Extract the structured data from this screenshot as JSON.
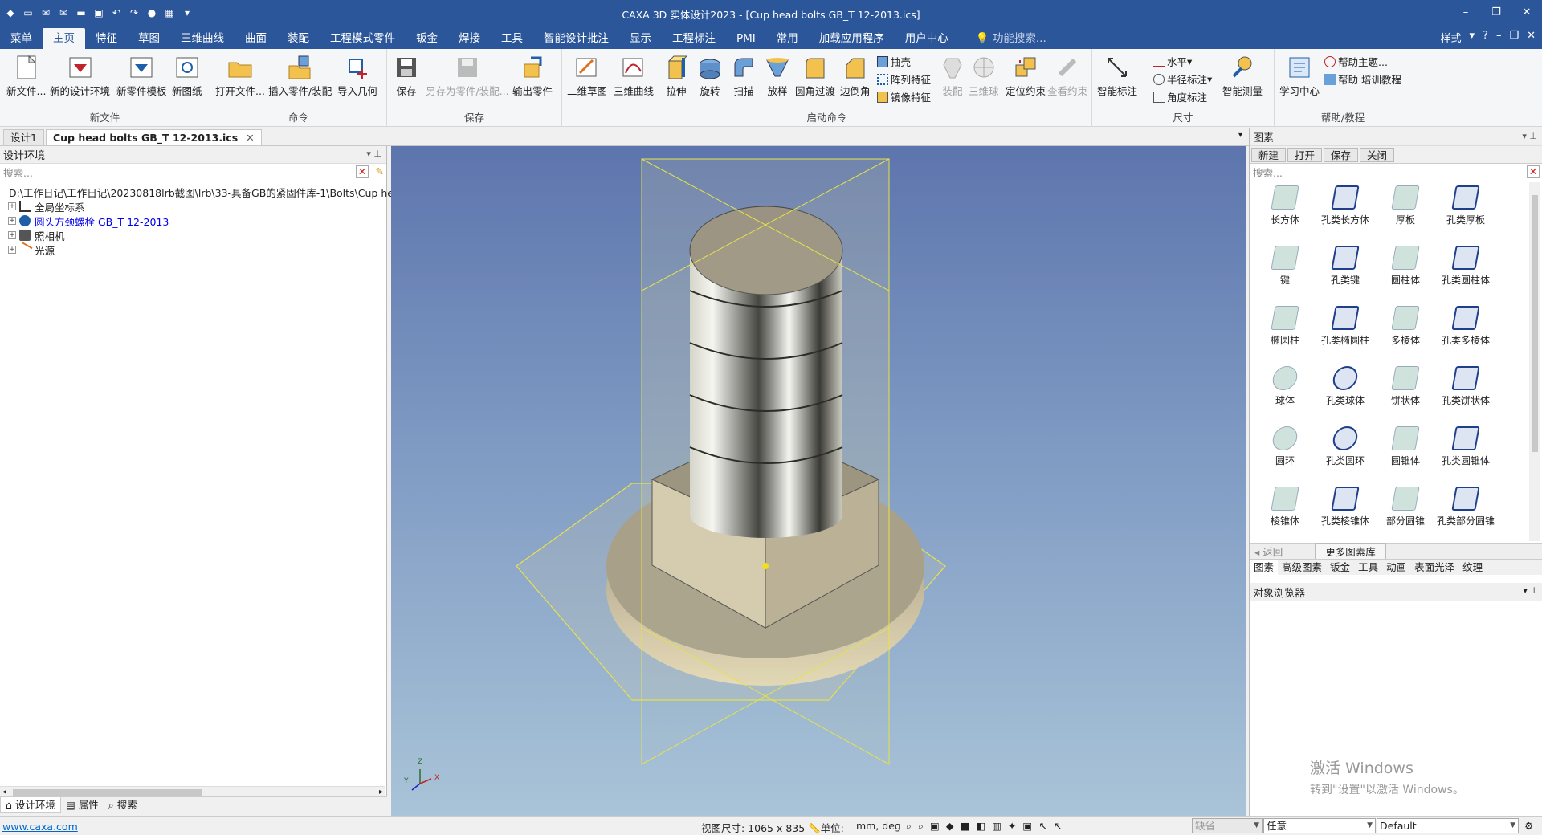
{
  "window": {
    "title": "CAXA 3D 实体设计2023 - [Cup head bolts GB_T 12-2013.ics]",
    "controls": [
      "–",
      "❐",
      "✕"
    ]
  },
  "menubar": {
    "items": [
      "菜单",
      "主页",
      "特征",
      "草图",
      "三维曲线",
      "曲面",
      "装配",
      "工程模式零件",
      "钣金",
      "焊接",
      "工具",
      "智能设计批注",
      "显示",
      "工程标注",
      "PMI",
      "常用",
      "加载应用程序",
      "用户中心"
    ],
    "active": "主页",
    "search_placeholder": "功能搜索...",
    "style_label": "样式"
  },
  "ribbon": {
    "groups": {
      "new_file": {
        "label": "新文件",
        "buttons": [
          "新文件...",
          "新的设计环境",
          "新零件模板",
          "新图纸"
        ]
      },
      "command": {
        "label": "命令",
        "buttons": [
          "打开文件...",
          "插入零件/装配",
          "导入几何"
        ]
      },
      "save": {
        "label": "保存",
        "buttons": [
          "保存",
          "另存为零件/装配...",
          "输出零件"
        ]
      },
      "launch": {
        "label": "启动命令",
        "buttons": [
          "二维草图",
          "三维曲线",
          "拉伸",
          "旋转",
          "扫描",
          "放样",
          "圆角过渡",
          "边倒角"
        ],
        "small": [
          "抽壳",
          "阵列特征",
          "镜像特征"
        ],
        "disabled": [
          "装配",
          "三维球"
        ],
        "more": [
          "定位约束",
          "查看约束"
        ]
      },
      "dimension": {
        "label": "尺寸",
        "buttons": [
          "智能标注",
          "智能测量"
        ],
        "small": [
          "水平",
          "半径标注",
          "角度标注"
        ]
      },
      "help": {
        "label": "帮助/教程",
        "buttons": [
          "学习中心"
        ],
        "small": [
          "帮助主题...",
          "帮助 培训教程"
        ]
      }
    }
  },
  "doc_tabs": [
    "设计1",
    "Cup head bolts GB_T 12-2013.ics"
  ],
  "left_panel": {
    "title": "设计环境",
    "search_placeholder": "搜索...",
    "tree": [
      {
        "label": "D:\\工作日记\\工作日记\\20230818lrb截图\\lrb\\33-具备GB的紧固件库-1\\Bolts\\Cup he"
      },
      {
        "label": "全局坐标系"
      },
      {
        "label": "圆头方颈螺栓 GB_T 12-2013",
        "color": "#0000ee"
      },
      {
        "label": "照相机"
      },
      {
        "label": "光源"
      }
    ],
    "tabs": [
      "设计环境",
      "属性",
      "搜索"
    ]
  },
  "right_panel": {
    "title": "图素",
    "toolbar": [
      "新建",
      "打开",
      "保存",
      "关闭"
    ],
    "search_placeholder": "搜索...",
    "items": [
      "长方体",
      "孔类长方体",
      "厚板",
      "孔类厚板",
      "键",
      "孔类键",
      "圆柱体",
      "孔类圆柱体",
      "椭圆柱",
      "孔类椭圆柱",
      "多棱体",
      "孔类多棱体",
      "球体",
      "孔类球体",
      "饼状体",
      "孔类饼状体",
      "圆环",
      "孔类圆环",
      "圆锥体",
      "孔类圆锥体",
      "棱锥体",
      "孔类棱锥体",
      "部分圆锥",
      "孔类部分圆锥"
    ],
    "back_label": "返回",
    "more_label": "更多图素库",
    "tabs": [
      "图素",
      "高级图素",
      "钣金",
      "工具",
      "动画",
      "表面光泽",
      "纹理"
    ],
    "object_browser": "对象浏览器",
    "watermark_line1": "激活 Windows",
    "watermark_line2": "转到\"设置\"以激活 Windows。"
  },
  "status": {
    "link": "www.caxa.com",
    "view_size": "视图尺寸: 1065 x  835",
    "unit_label": "单位:",
    "unit_value": "mm, deg",
    "combo1": "缺省",
    "combo2": "任意",
    "combo3": "Default"
  },
  "axis_labels": {
    "z": "Z",
    "x": "X",
    "y": "Y"
  },
  "colors": {
    "accent": "#2b579a",
    "tree_link": "#0000ee"
  }
}
